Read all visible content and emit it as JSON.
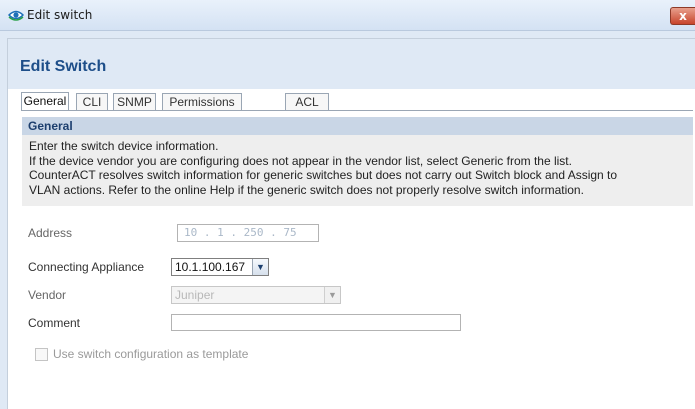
{
  "window": {
    "title": "Edit switch",
    "close_symbol": "x"
  },
  "dialog": {
    "heading": "Edit Switch"
  },
  "tabs": [
    {
      "label": "General",
      "active": true
    },
    {
      "label": "CLI",
      "active": false
    },
    {
      "label": "SNMP",
      "active": false
    },
    {
      "label": "Permissions",
      "active": false
    },
    {
      "label": "ACL",
      "active": false
    }
  ],
  "section": {
    "title": "General",
    "info_lines": [
      "Enter the switch device information.",
      "If the device vendor you are configuring does not appear in the vendor list, select Generic from the list.",
      "CounterACT resolves switch information for generic switches but does not carry out Switch block and Assign to",
      "VLAN actions. Refer to the online Help if the generic switch does not properly resolve switch information."
    ]
  },
  "form": {
    "address": {
      "label": "Address",
      "value": "10 . 1 . 250 . 75"
    },
    "connecting_appliance": {
      "label": "Connecting Appliance",
      "value": "10.1.100.167"
    },
    "vendor": {
      "label": "Vendor",
      "value": "Juniper"
    },
    "comment": {
      "label": "Comment",
      "value": ""
    },
    "template_checkbox": {
      "label": "Use switch configuration as template",
      "checked": false
    }
  },
  "icons": {
    "app": "eye-icon",
    "close": "close-icon",
    "dropdown": "chevron-down-icon"
  },
  "colors": {
    "title_text": "#1d4e89",
    "section_header_bg": "#c9d6e6",
    "close_button": "#c8452c"
  }
}
